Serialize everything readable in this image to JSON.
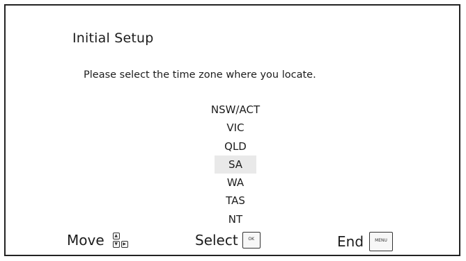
{
  "setup": {
    "title": "Initial Setup",
    "instruction": "Please select the time zone where you locate.",
    "selected_zone": "SA",
    "zones": [
      "NSW/ACT",
      "VIC",
      "QLD",
      "SA",
      "WA",
      "TAS",
      "NT"
    ]
  },
  "footer": {
    "move_label": "Move",
    "select_label": "Select",
    "ok_key_label": "OK",
    "end_label": "End",
    "menu_key_label": "MENU"
  },
  "icons": {
    "dpad": "directional-keys-icon",
    "ok": "ok-key-icon",
    "menu": "menu-key-icon"
  }
}
